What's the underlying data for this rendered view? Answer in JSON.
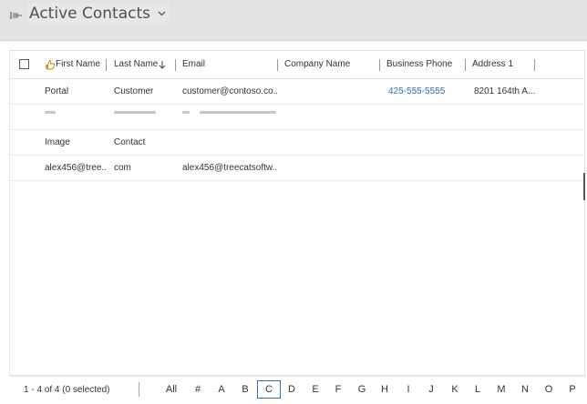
{
  "view": {
    "title": "Active Contacts"
  },
  "columns": [
    "First Name",
    "Last Name",
    "Email",
    "Company Name",
    "Business Phone",
    "Address 1"
  ],
  "rows": [
    {
      "first": "Portal",
      "last": "Customer",
      "email": "customer@contoso.co...",
      "company": "",
      "phone": "425-555-5555",
      "address": "8201 164th A..."
    },
    {
      "first": "",
      "last": "",
      "email": "",
      "company": "",
      "phone": "",
      "address": ""
    },
    {
      "first": "Image",
      "last": "Contact",
      "email": "",
      "company": "",
      "phone": "",
      "address": ""
    },
    {
      "first": "alex456@tree...",
      "last": "com",
      "email": "alex456@treecatsoftw...",
      "company": "",
      "phone": "",
      "address": ""
    }
  ],
  "footer": {
    "record_count": "1 - 4 of 4 (0 selected)",
    "letters": [
      "All",
      "#",
      "A",
      "B",
      "C",
      "D",
      "E",
      "F",
      "G",
      "H",
      "I",
      "J",
      "K",
      "L",
      "M",
      "N",
      "O",
      "P"
    ],
    "active_letter": "C"
  },
  "colors": {
    "header_bg": "#e3e3e3",
    "link": "#2e6fb7",
    "accent_icon": "#e8a317"
  }
}
